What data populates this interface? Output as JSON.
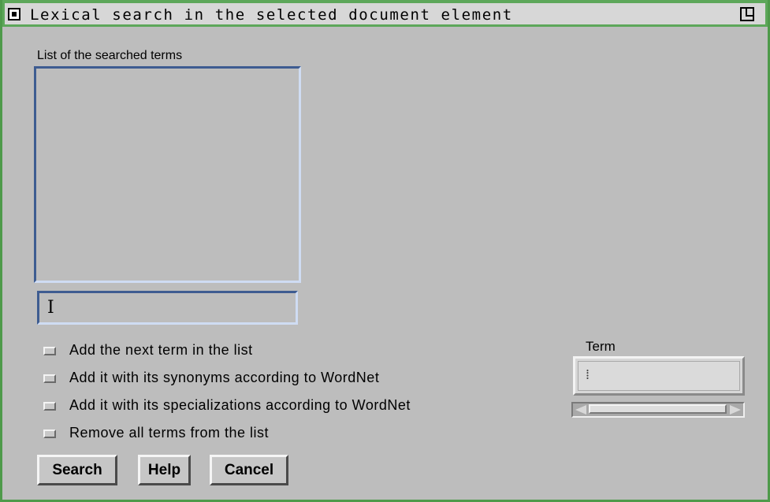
{
  "window": {
    "title": "Lexical search in the selected document element",
    "menu_icon": "window-menu-icon",
    "maximize_icon": "maximize-icon"
  },
  "terms_panel": {
    "label": "List of the searched terms",
    "entry_value": "",
    "entry_cursor_icon": "text-cursor-icon"
  },
  "options": [
    {
      "label": "Add the next term in the list",
      "checked": false
    },
    {
      "label": "Add it with its synonyms according to WordNet",
      "checked": false
    },
    {
      "label": "Add it with its specializations according to WordNet",
      "checked": false
    },
    {
      "label": "Remove all terms from the list",
      "checked": false
    }
  ],
  "term": {
    "label": "Term",
    "value": "",
    "scroll_left_icon": "arrow-left-icon",
    "scroll_right_icon": "arrow-right-icon"
  },
  "buttons": {
    "search": "Search",
    "help": "Help",
    "cancel": "Cancel"
  },
  "colors": {
    "background": "#bdbdbd",
    "window_border": "#4e9a4a",
    "field_dark_bevel": "#3e5c91",
    "field_light_bevel": "#cfdcf3"
  }
}
